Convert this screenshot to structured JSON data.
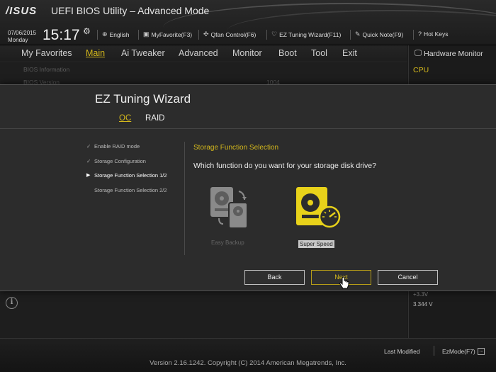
{
  "header": {
    "logo": "/ISUS",
    "title": "UEFI BIOS Utility – Advanced Mode",
    "date": "07/06/2015",
    "day": "Monday",
    "time": "15:17",
    "tools": [
      {
        "label": "English",
        "icon": "globe-icon"
      },
      {
        "label": "MyFavorite(F3)",
        "icon": "favorite-icon"
      },
      {
        "label": "Qfan Control(F6)",
        "icon": "fan-icon"
      },
      {
        "label": "EZ Tuning Wizard(F11)",
        "icon": "wizard-icon"
      },
      {
        "label": "Quick Note(F9)",
        "icon": "note-icon"
      },
      {
        "label": "Hot Keys",
        "icon": "question-icon"
      }
    ]
  },
  "menu": {
    "items": [
      "My Favorites",
      "Main",
      "Ai Tweaker",
      "Advanced",
      "Monitor",
      "Boot",
      "Tool",
      "Exit"
    ],
    "active": "Main"
  },
  "background": {
    "rows": [
      "BIOS Information",
      "BIOS Version"
    ],
    "bios_version_value": "1004"
  },
  "hardware_monitor": {
    "title": "Hardware Monitor",
    "cpu_label": "CPU",
    "voltage_label": "+3.3V",
    "voltage_value": "3.344 V"
  },
  "dialog": {
    "title": "EZ Tuning Wizard",
    "tabs": [
      "OC",
      "RAID"
    ],
    "active_tab": "OC",
    "steps": [
      {
        "mark": "✓",
        "label": "Enable RAID mode"
      },
      {
        "mark": "✓",
        "label": "Storage Configuration"
      },
      {
        "mark": "▶",
        "label": "Storage Function Selection 1/2"
      },
      {
        "mark": "",
        "label": "Storage Function Selection 2/2"
      }
    ],
    "section_title": "Storage Function Selection",
    "question": "Which function do you want for your storage disk drive?",
    "options": [
      {
        "label": "Easy Backup",
        "selected": false,
        "icon": "easy-backup-icon"
      },
      {
        "label": "Super Speed",
        "selected": true,
        "icon": "super-speed-icon"
      }
    ],
    "buttons": {
      "back": "Back",
      "next": "Next",
      "cancel": "Cancel"
    }
  },
  "footer": {
    "last_modified": "Last Modified",
    "ezmode": "EzMode(F7)",
    "version": "Version 2.16.1242. Copyright (C) 2014 American Megatrends, Inc."
  },
  "colors": {
    "accent": "#d4b81c",
    "background": "#1e1e1e",
    "dialog": "#2c2c2c"
  }
}
